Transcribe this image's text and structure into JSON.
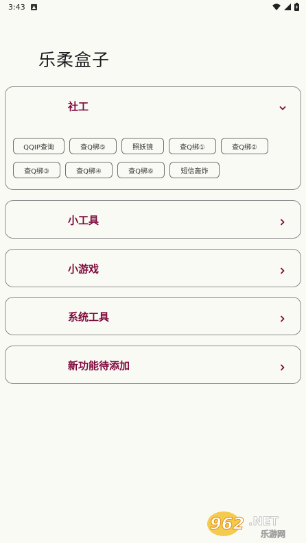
{
  "status": {
    "time": "3:43"
  },
  "title": "乐柔盒子",
  "sections": [
    {
      "label": "社工"
    },
    {
      "label": "小工具"
    },
    {
      "label": "小游戏"
    },
    {
      "label": "系统工具"
    },
    {
      "label": "新功能待添加"
    }
  ],
  "chips": [
    "QQIP查询",
    "查Q绑⑤",
    "照妖镜",
    "查Q绑①",
    "查Q绑②",
    "查Q绑③",
    "查Q绑④",
    "查Q绑⑥",
    "短信轰炸"
  ],
  "watermark": {
    "main": "962.NET",
    "sub": "乐游网"
  },
  "colors": {
    "accent": "#7d0a3c",
    "background": "#fafaf5",
    "border": "#8a8a8a"
  }
}
